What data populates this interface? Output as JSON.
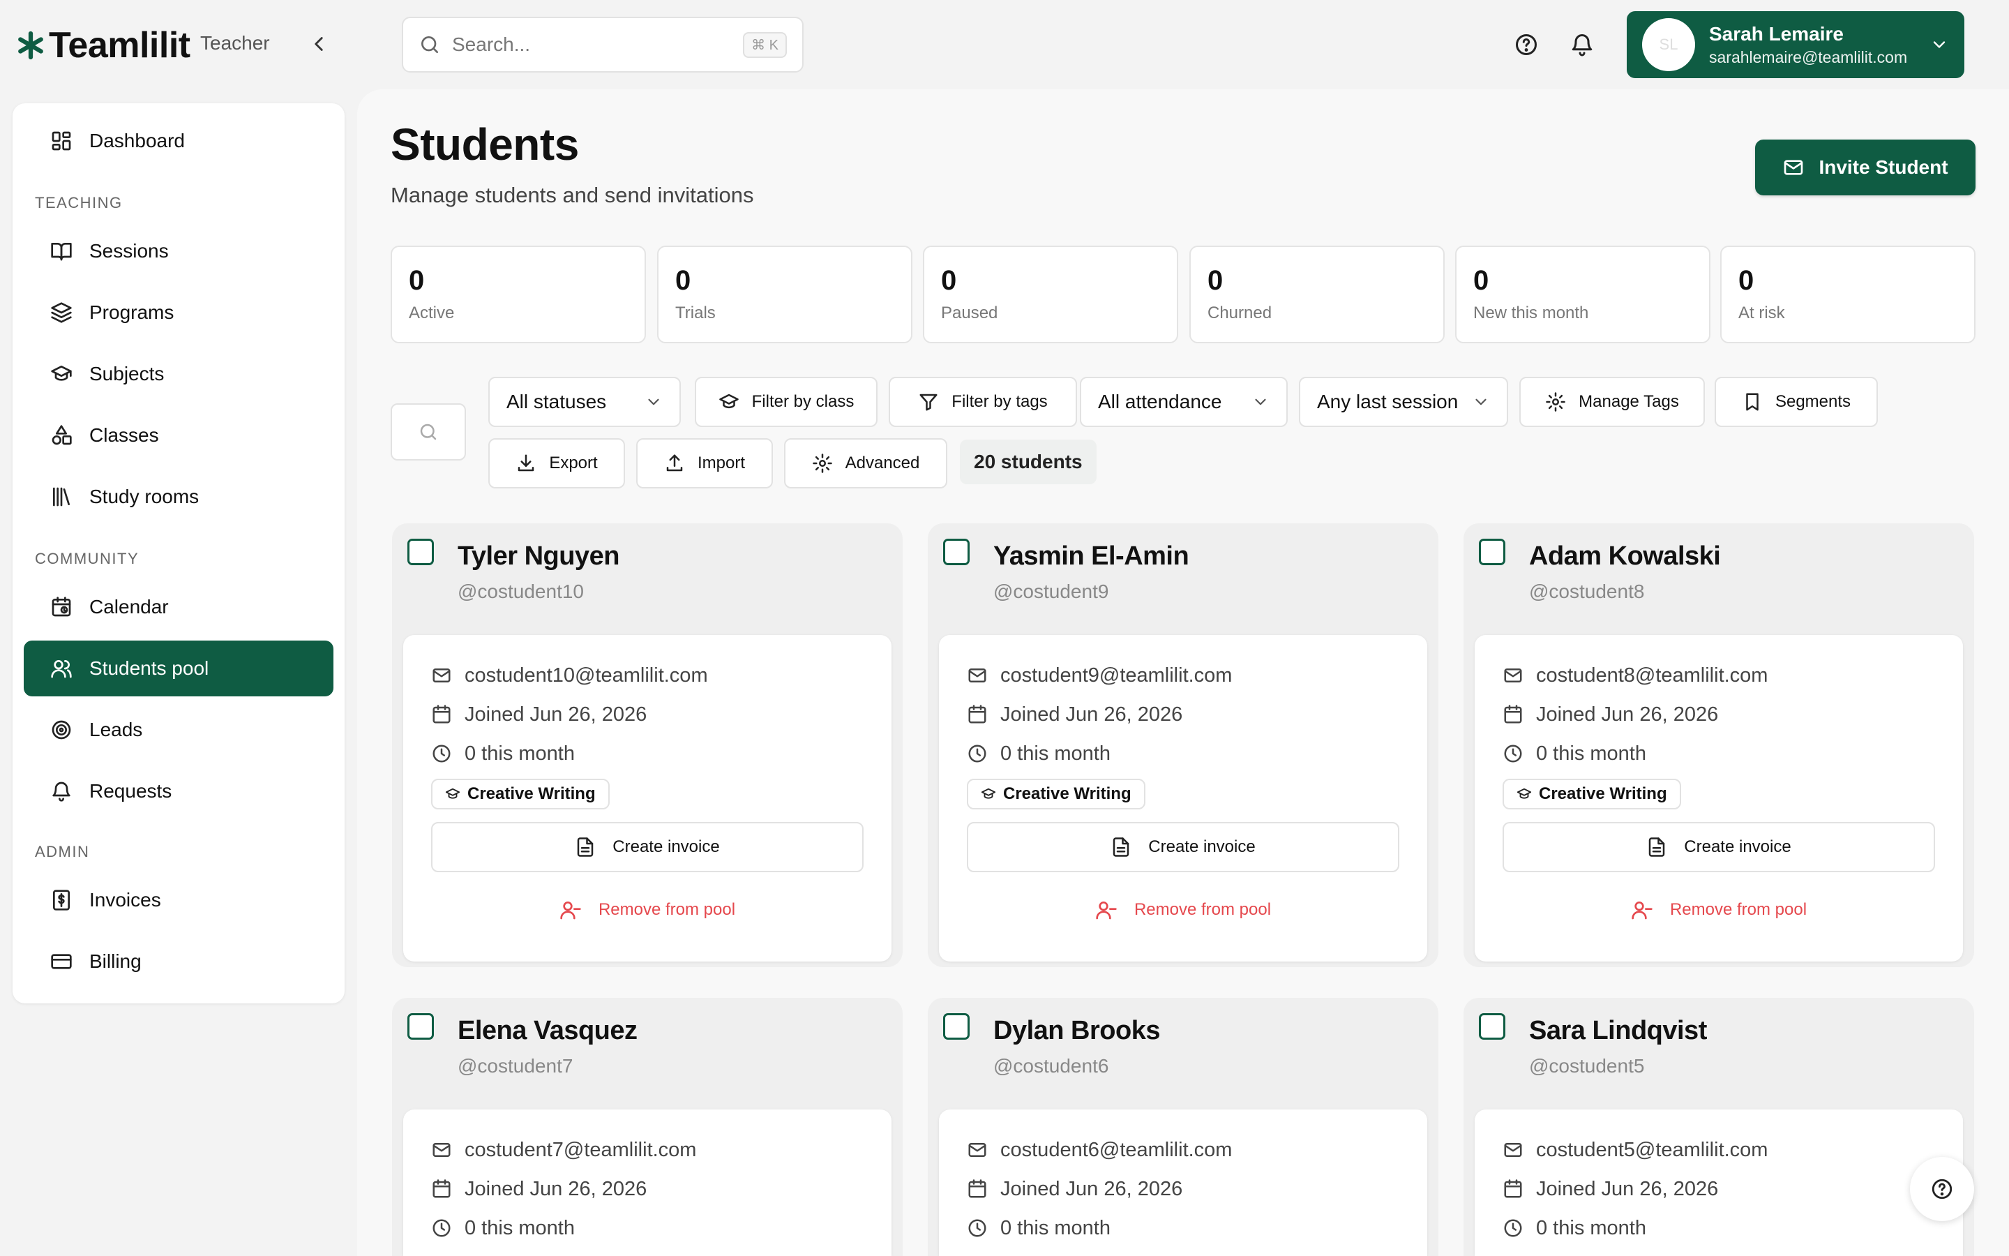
{
  "brand": {
    "name": "Teamlilit",
    "role": "Teacher"
  },
  "search": {
    "placeholder": "Search...",
    "shortcut": "⌘ K"
  },
  "user": {
    "name": "Sarah Lemaire",
    "email": "sarahlemaire@teamlilit.com",
    "initials": "SL"
  },
  "sidebar": {
    "dashboard": "Dashboard",
    "sections": {
      "teaching": "TEACHING",
      "community": "COMMUNITY",
      "admin": "ADMIN"
    },
    "items": [
      {
        "label": "Sessions"
      },
      {
        "label": "Programs"
      },
      {
        "label": "Subjects"
      },
      {
        "label": "Classes"
      },
      {
        "label": "Study rooms"
      },
      {
        "label": "Calendar"
      },
      {
        "label": "Students pool"
      },
      {
        "label": "Leads"
      },
      {
        "label": "Requests"
      },
      {
        "label": "Invoices"
      },
      {
        "label": "Billing"
      }
    ]
  },
  "page": {
    "title": "Students",
    "subtitle": "Manage students and send invitations",
    "invite_label": "Invite Student"
  },
  "stats": [
    {
      "value": "0",
      "label": "Active"
    },
    {
      "value": "0",
      "label": "Trials"
    },
    {
      "value": "0",
      "label": "Paused"
    },
    {
      "value": "0",
      "label": "Churned"
    },
    {
      "value": "0",
      "label": "New this month"
    },
    {
      "value": "0",
      "label": "At risk"
    }
  ],
  "toolbar": {
    "status_select": "All statuses",
    "filter_class": "Filter by class",
    "filter_tags": "Filter by tags",
    "attendance_select": "All attendance",
    "last_session_select": "Any last session",
    "manage_tags": "Manage Tags",
    "segments": "Segments",
    "export": "Export",
    "import": "Import",
    "advanced": "Advanced",
    "count": "20 students"
  },
  "card_labels": {
    "create_invoice": "Create invoice",
    "remove": "Remove from pool"
  },
  "students": [
    {
      "name": "Tyler Nguyen",
      "handle": "@costudent10",
      "email": "costudent10@teamlilit.com",
      "joined": "Joined Jun 26, 2026",
      "month": "0 this month",
      "tag": "Creative Writing"
    },
    {
      "name": "Yasmin El-Amin",
      "handle": "@costudent9",
      "email": "costudent9@teamlilit.com",
      "joined": "Joined Jun 26, 2026",
      "month": "0 this month",
      "tag": "Creative Writing"
    },
    {
      "name": "Adam Kowalski",
      "handle": "@costudent8",
      "email": "costudent8@teamlilit.com",
      "joined": "Joined Jun 26, 2026",
      "month": "0 this month",
      "tag": "Creative Writing"
    },
    {
      "name": "Elena Vasquez",
      "handle": "@costudent7",
      "email": "costudent7@teamlilit.com",
      "joined": "Joined Jun 26, 2026",
      "month": "0 this month"
    },
    {
      "name": "Dylan Brooks",
      "handle": "@costudent6",
      "email": "costudent6@teamlilit.com",
      "joined": "Joined Jun 26, 2026",
      "month": "0 this month"
    },
    {
      "name": "Sara Lindqvist",
      "handle": "@costudent5",
      "email": "costudent5@teamlilit.com",
      "joined": "Joined Jun 26, 2026",
      "month": "0 this month"
    }
  ],
  "colors": {
    "brand_green": "#0f5c43",
    "danger": "#e5484d"
  }
}
